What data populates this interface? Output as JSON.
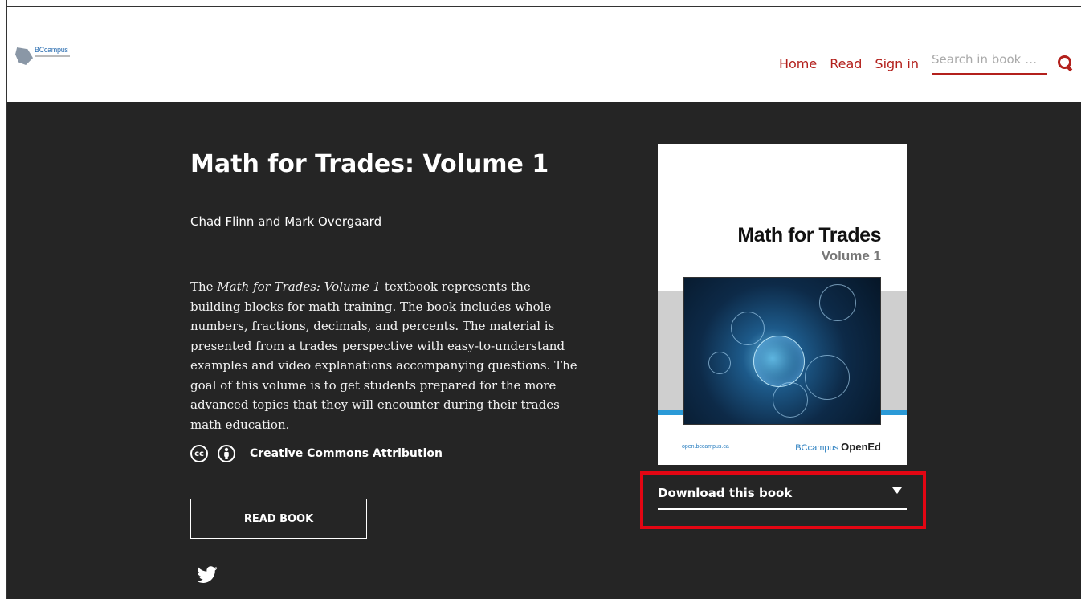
{
  "header": {
    "logo_text": "BCcampus",
    "nav": [
      "Home",
      "Read",
      "Sign in"
    ],
    "search_placeholder": "Search in book …"
  },
  "book": {
    "title": "Math for Trades: Volume 1",
    "authors": "Chad Flinn and Mark Overgaard",
    "description_prefix": "The ",
    "description_title": "Math for Trades: Volume 1",
    "description_rest": " textbook represents the building blocks for math training. The book includes whole numbers, fractions, decimals, and percents. The material is presented from a trades perspective with easy-to-understand examples and video explanations accompanying questions. The goal of this volume is to get students prepared for the more advanced topics that they will encounter during their trades math education.",
    "license_icons": [
      "cc",
      "by"
    ],
    "license": "Creative Commons Attribution",
    "read_button": "READ BOOK",
    "share": "twitter"
  },
  "cover": {
    "title": "Math for Trades",
    "volume": "Volume 1",
    "footer_left": "open.bccampus.ca",
    "footer_right_a": "BCcampus",
    "footer_right_b": "OpenEd"
  },
  "download": {
    "label": "Download this book"
  },
  "colors": {
    "accent": "#b3201c",
    "hero_bg": "#252525",
    "highlight": "#e30613"
  }
}
